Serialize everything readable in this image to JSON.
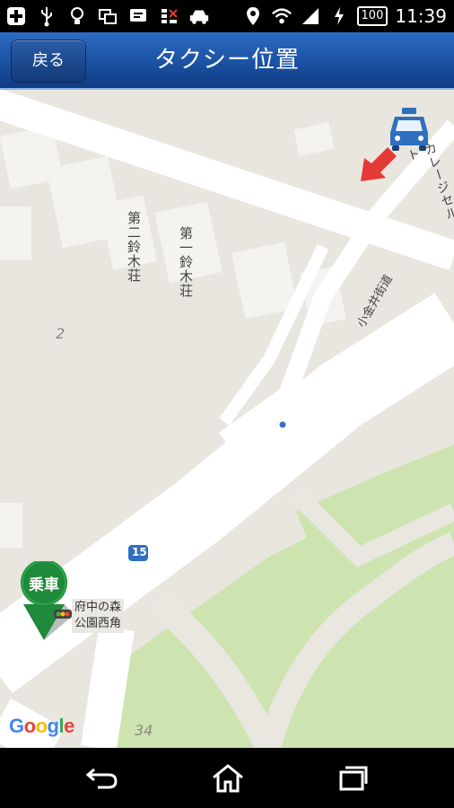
{
  "status_bar": {
    "battery": "100",
    "time": "11:39",
    "left_icons": [
      "plus-icon",
      "usb-icon",
      "bulb-icon",
      "screen-icon",
      "chat-icon",
      "signal-off-icon",
      "car-icon"
    ],
    "right_icons": [
      "location-icon",
      "wifi-icon",
      "cell-signal-icon",
      "charging-icon",
      "battery-icon"
    ]
  },
  "header": {
    "back_label": "戻る",
    "title": "タクシー位置"
  },
  "map": {
    "labels": {
      "building1": "第二鈴木荘",
      "building2": "第一鈴木荘",
      "street": "小金井街道",
      "block2": "2",
      "block34": "34",
      "route": "15",
      "garage": "カレージセルト"
    },
    "pickup_badge": "乗車",
    "stop_name_line1": "府中の森",
    "stop_name_line2": "公園西角",
    "google": [
      "G",
      "o",
      "o",
      "g",
      "l",
      "e"
    ],
    "colors": {
      "land": "#e8e6df",
      "road": "#ffffff",
      "park": "#cde4b0",
      "building": "#f4f3ef",
      "pin": "#1e8a3a",
      "arrow": "#e53935",
      "taxi": "#2f6fc0"
    }
  },
  "nav_bar": {
    "icons": [
      "back-icon",
      "home-icon",
      "recents-icon"
    ]
  }
}
